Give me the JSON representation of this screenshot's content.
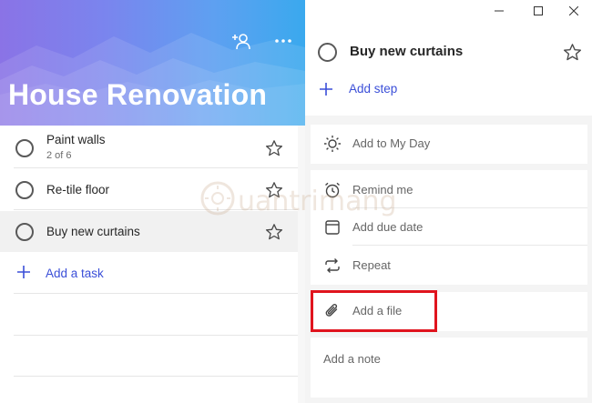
{
  "list": {
    "title": "House Renovation",
    "tasks": [
      {
        "title": "Paint walls",
        "subtitle": "2 of 6",
        "selected": false
      },
      {
        "title": "Re-tile floor",
        "subtitle": "",
        "selected": false
      },
      {
        "title": "Buy new curtains",
        "subtitle": "",
        "selected": true
      }
    ],
    "add_task_label": "Add a task"
  },
  "detail": {
    "title": "Buy new curtains",
    "add_step_label": "Add step",
    "my_day_label": "Add to My Day",
    "remind_label": "Remind me",
    "due_date_label": "Add due date",
    "repeat_label": "Repeat",
    "add_file_label": "Add a file",
    "note_label": "Add a note"
  },
  "watermark": {
    "text": "uantrimang"
  },
  "icons": {
    "share": "add-person-icon",
    "more": "more-icon",
    "complete": "circle-checkbox-icon",
    "importance": "star-icon",
    "add": "plus-icon",
    "my_day": "sun-icon",
    "remind": "alarm-clock-icon",
    "due": "calendar-icon",
    "repeat": "repeat-icon",
    "file": "paperclip-icon",
    "minimize": "minimize-icon",
    "maximize": "maximize-icon",
    "close": "close-icon"
  },
  "colors": {
    "accent": "#3b4fd8",
    "highlight": "#e0141e",
    "banner_start": "#8a73e6",
    "banner_end": "#3aa9ee"
  }
}
